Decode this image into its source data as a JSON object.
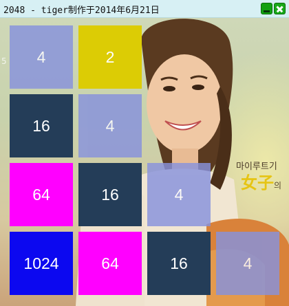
{
  "window": {
    "title": "2048 - tiger制作于2014年6月21日"
  },
  "background": {
    "poster_korean": "마이루트기",
    "poster_chinese": "女子",
    "poster_suffix": "의",
    "side_text": "5"
  },
  "board": {
    "rows": [
      [
        "4",
        "2",
        "",
        ""
      ],
      [
        "16",
        "4",
        "",
        ""
      ],
      [
        "64",
        "16",
        "4",
        ""
      ],
      [
        "1024",
        "64",
        "16",
        "4"
      ]
    ]
  },
  "colors": {
    "tile_2": "#dccc05",
    "tile_4": "#8792dd",
    "tile_16": "#243d58",
    "tile_64": "#ff00ff",
    "tile_1024": "#0c08f0",
    "titlebar": "#d7f0f4"
  }
}
